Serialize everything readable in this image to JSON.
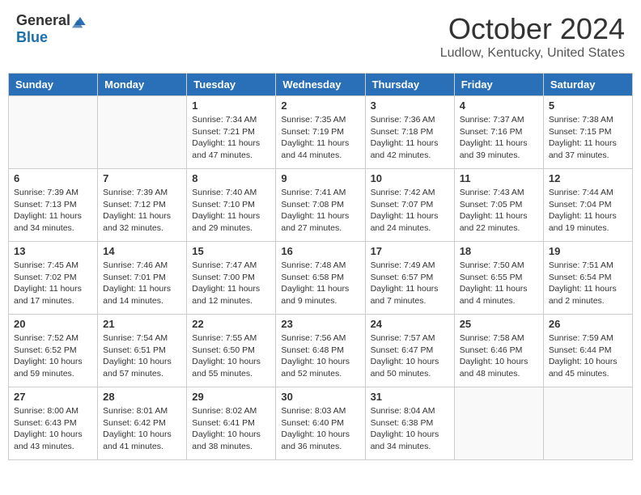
{
  "header": {
    "logo_general": "General",
    "logo_blue": "Blue",
    "month_title": "October 2024",
    "location": "Ludlow, Kentucky, United States"
  },
  "weekdays": [
    "Sunday",
    "Monday",
    "Tuesday",
    "Wednesday",
    "Thursday",
    "Friday",
    "Saturday"
  ],
  "weeks": [
    [
      {
        "day": "",
        "info": ""
      },
      {
        "day": "",
        "info": ""
      },
      {
        "day": "1",
        "info": "Sunrise: 7:34 AM\nSunset: 7:21 PM\nDaylight: 11 hours and 47 minutes."
      },
      {
        "day": "2",
        "info": "Sunrise: 7:35 AM\nSunset: 7:19 PM\nDaylight: 11 hours and 44 minutes."
      },
      {
        "day": "3",
        "info": "Sunrise: 7:36 AM\nSunset: 7:18 PM\nDaylight: 11 hours and 42 minutes."
      },
      {
        "day": "4",
        "info": "Sunrise: 7:37 AM\nSunset: 7:16 PM\nDaylight: 11 hours and 39 minutes."
      },
      {
        "day": "5",
        "info": "Sunrise: 7:38 AM\nSunset: 7:15 PM\nDaylight: 11 hours and 37 minutes."
      }
    ],
    [
      {
        "day": "6",
        "info": "Sunrise: 7:39 AM\nSunset: 7:13 PM\nDaylight: 11 hours and 34 minutes."
      },
      {
        "day": "7",
        "info": "Sunrise: 7:39 AM\nSunset: 7:12 PM\nDaylight: 11 hours and 32 minutes."
      },
      {
        "day": "8",
        "info": "Sunrise: 7:40 AM\nSunset: 7:10 PM\nDaylight: 11 hours and 29 minutes."
      },
      {
        "day": "9",
        "info": "Sunrise: 7:41 AM\nSunset: 7:08 PM\nDaylight: 11 hours and 27 minutes."
      },
      {
        "day": "10",
        "info": "Sunrise: 7:42 AM\nSunset: 7:07 PM\nDaylight: 11 hours and 24 minutes."
      },
      {
        "day": "11",
        "info": "Sunrise: 7:43 AM\nSunset: 7:05 PM\nDaylight: 11 hours and 22 minutes."
      },
      {
        "day": "12",
        "info": "Sunrise: 7:44 AM\nSunset: 7:04 PM\nDaylight: 11 hours and 19 minutes."
      }
    ],
    [
      {
        "day": "13",
        "info": "Sunrise: 7:45 AM\nSunset: 7:02 PM\nDaylight: 11 hours and 17 minutes."
      },
      {
        "day": "14",
        "info": "Sunrise: 7:46 AM\nSunset: 7:01 PM\nDaylight: 11 hours and 14 minutes."
      },
      {
        "day": "15",
        "info": "Sunrise: 7:47 AM\nSunset: 7:00 PM\nDaylight: 11 hours and 12 minutes."
      },
      {
        "day": "16",
        "info": "Sunrise: 7:48 AM\nSunset: 6:58 PM\nDaylight: 11 hours and 9 minutes."
      },
      {
        "day": "17",
        "info": "Sunrise: 7:49 AM\nSunset: 6:57 PM\nDaylight: 11 hours and 7 minutes."
      },
      {
        "day": "18",
        "info": "Sunrise: 7:50 AM\nSunset: 6:55 PM\nDaylight: 11 hours and 4 minutes."
      },
      {
        "day": "19",
        "info": "Sunrise: 7:51 AM\nSunset: 6:54 PM\nDaylight: 11 hours and 2 minutes."
      }
    ],
    [
      {
        "day": "20",
        "info": "Sunrise: 7:52 AM\nSunset: 6:52 PM\nDaylight: 10 hours and 59 minutes."
      },
      {
        "day": "21",
        "info": "Sunrise: 7:54 AM\nSunset: 6:51 PM\nDaylight: 10 hours and 57 minutes."
      },
      {
        "day": "22",
        "info": "Sunrise: 7:55 AM\nSunset: 6:50 PM\nDaylight: 10 hours and 55 minutes."
      },
      {
        "day": "23",
        "info": "Sunrise: 7:56 AM\nSunset: 6:48 PM\nDaylight: 10 hours and 52 minutes."
      },
      {
        "day": "24",
        "info": "Sunrise: 7:57 AM\nSunset: 6:47 PM\nDaylight: 10 hours and 50 minutes."
      },
      {
        "day": "25",
        "info": "Sunrise: 7:58 AM\nSunset: 6:46 PM\nDaylight: 10 hours and 48 minutes."
      },
      {
        "day": "26",
        "info": "Sunrise: 7:59 AM\nSunset: 6:44 PM\nDaylight: 10 hours and 45 minutes."
      }
    ],
    [
      {
        "day": "27",
        "info": "Sunrise: 8:00 AM\nSunset: 6:43 PM\nDaylight: 10 hours and 43 minutes."
      },
      {
        "day": "28",
        "info": "Sunrise: 8:01 AM\nSunset: 6:42 PM\nDaylight: 10 hours and 41 minutes."
      },
      {
        "day": "29",
        "info": "Sunrise: 8:02 AM\nSunset: 6:41 PM\nDaylight: 10 hours and 38 minutes."
      },
      {
        "day": "30",
        "info": "Sunrise: 8:03 AM\nSunset: 6:40 PM\nDaylight: 10 hours and 36 minutes."
      },
      {
        "day": "31",
        "info": "Sunrise: 8:04 AM\nSunset: 6:38 PM\nDaylight: 10 hours and 34 minutes."
      },
      {
        "day": "",
        "info": ""
      },
      {
        "day": "",
        "info": ""
      }
    ]
  ]
}
